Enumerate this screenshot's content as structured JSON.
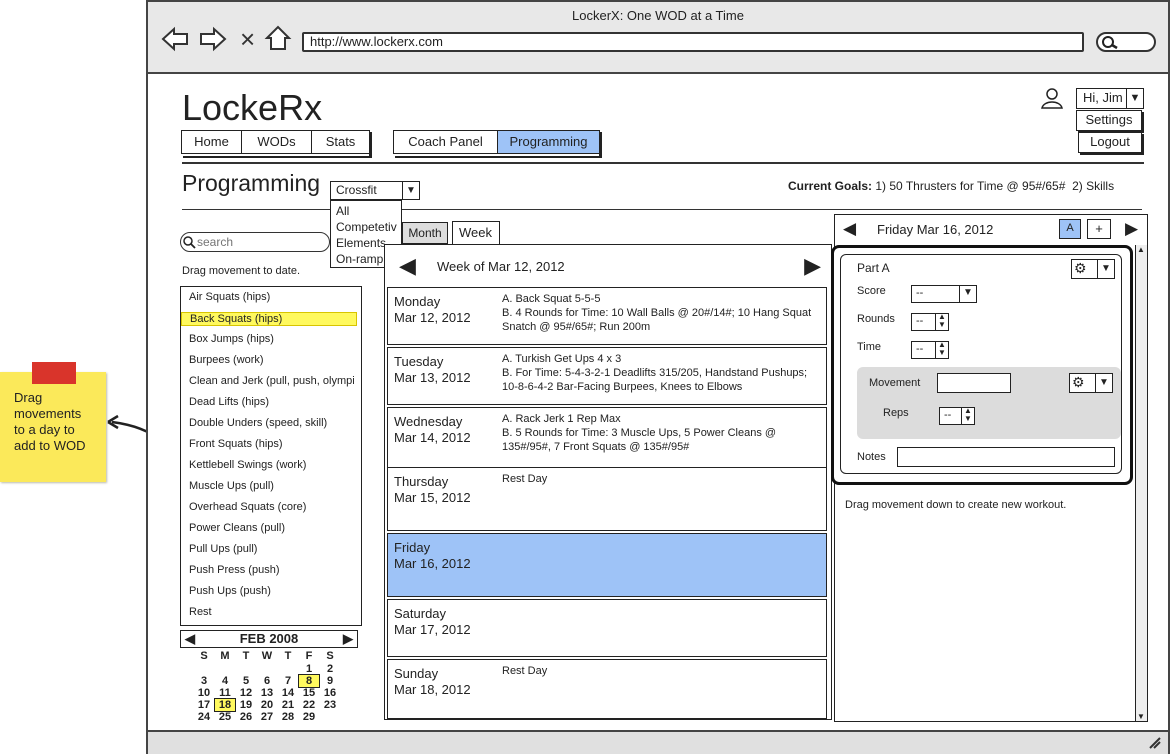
{
  "browser": {
    "title": "LockerX: One WOD at a Time",
    "url": "http://www.lockerx.com",
    "close_glyph": "×"
  },
  "app": {
    "logo": "LockeRx",
    "nav": [
      "Home",
      "WODs",
      "Stats"
    ],
    "nav2": [
      "Coach Panel",
      "Programming"
    ],
    "user_greeting": "Hi, Jim",
    "user_menu": [
      "Settings",
      "Logout"
    ]
  },
  "page": {
    "title": "Programming",
    "filter_selected": "Crossfit",
    "filter_options": [
      "All",
      "Competetiv",
      "Elements",
      "On-ramp"
    ],
    "goals_label": "Current Goals:",
    "goals_text": " 1) 50 Thrusters for Time @ 95#/65#  2) Skills"
  },
  "movements": {
    "search_placeholder": "search",
    "hint": "Drag movement to date.",
    "items": [
      "Air Squats (hips)",
      "Back Squats (hips)",
      "Box Jumps (hips)",
      "Burpees (work)",
      "Clean and Jerk (pull, push, olympi",
      "Dead Lifts (hips)",
      "Double Unders (speed, skill)",
      "Front Squats (hips)",
      "Kettlebell Swings (work)",
      "Muscle Ups (pull)",
      "Overhead Squats (core)",
      "Power Cleans (pull)",
      "Pull Ups (pull)",
      "Push Press (push)",
      "Push Ups (push)",
      "Rest"
    ],
    "highlighted_index": 1
  },
  "calendar": {
    "month_label": "FEB 2008",
    "dow": [
      "S",
      "M",
      "T",
      "W",
      "T",
      "F",
      "S"
    ],
    "weeks": [
      [
        "",
        "",
        "",
        "",
        "",
        "1",
        "2"
      ],
      [
        "3",
        "4",
        "5",
        "6",
        "7",
        "8",
        "9"
      ],
      [
        "10",
        "11",
        "12",
        "13",
        "14",
        "15",
        "16"
      ],
      [
        "17",
        "18",
        "19",
        "20",
        "21",
        "22",
        "23"
      ],
      [
        "24",
        "25",
        "26",
        "27",
        "28",
        "29",
        ""
      ]
    ]
  },
  "week_view": {
    "tabs": [
      "Month",
      "Week"
    ],
    "active_tab": "Week",
    "week_label": "Week of Mar 12, 2012",
    "days": [
      {
        "day": "Monday",
        "date": "Mar 12, 2012",
        "wod": "A. Back Squat 5-5-5\nB. 4 Rounds for Time: 10 Wall Balls @ 20#/14#; 10 Hang Squat Snatch @ 95#/65#; Run 200m",
        "selected": false
      },
      {
        "day": "Tuesday",
        "date": "Mar 13, 2012",
        "wod": "A. Turkish Get Ups 4 x 3\nB. For Time: 5-4-3-2-1 Deadlifts 315/205, Handstand Pushups; 10-8-6-4-2 Bar-Facing Burpees, Knees to Elbows",
        "selected": false
      },
      {
        "day": "Wednesday",
        "date": "Mar 14, 2012",
        "wod": "A.  Rack Jerk 1 Rep Max\nB.  5 Rounds for Time: 3 Muscle Ups, 5 Power Cleans @ 135#/95#, 7 Front Squats @ 135#/95#",
        "selected": false
      },
      {
        "day": "Thursday",
        "date": "Mar 15, 2012",
        "wod": "Rest Day",
        "selected": false
      },
      {
        "day": "Friday",
        "date": "Mar 16, 2012",
        "wod": "",
        "selected": true
      },
      {
        "day": "Saturday",
        "date": "Mar 17, 2012",
        "wod": "",
        "selected": false
      },
      {
        "day": "Sunday",
        "date": "Mar 18, 2012",
        "wod": "Rest Day",
        "selected": false
      }
    ]
  },
  "editor": {
    "date_label": "Friday Mar 16, 2012",
    "part_button": "A",
    "add_button": "+",
    "part_title": "Part A",
    "score_label": "Score",
    "score_value": "--",
    "rounds_label": "Rounds",
    "rounds_value": "--",
    "time_label": "Time",
    "time_value": "--",
    "movement_label": "Movement",
    "reps_label": "Reps",
    "reps_value": "--",
    "notes_label": "Notes",
    "drag_hint": "Drag movement down to create new workout."
  },
  "annotation": {
    "note_text": "Drag movements to a day to add to WOD"
  },
  "colors": {
    "selected_day": "#9ec3f7",
    "highlight": "#fff95e",
    "sticky": "#fbe95a",
    "sticky_tab": "#d9342b",
    "active_tab": "#9ec3f7"
  }
}
